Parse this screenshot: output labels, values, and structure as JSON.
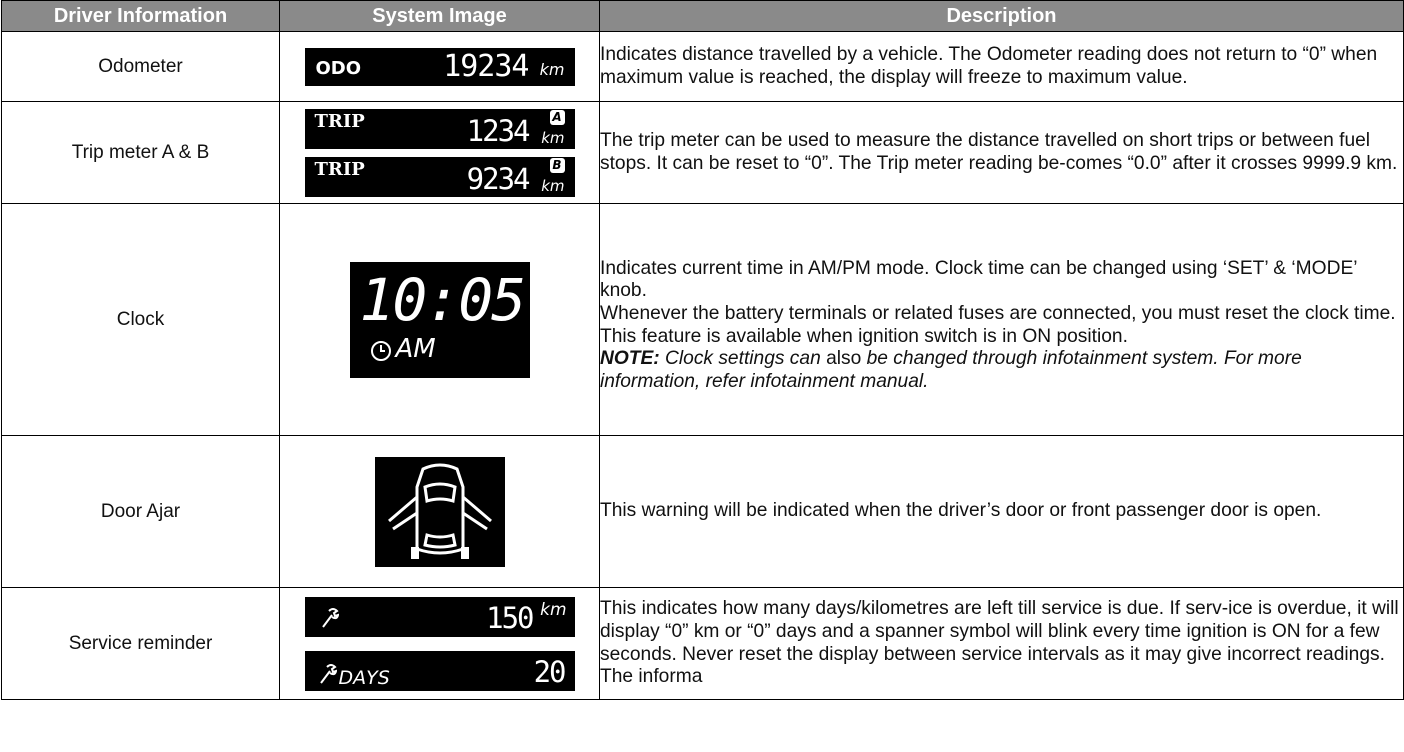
{
  "headers": [
    "Driver Information",
    "System Image",
    "Description"
  ],
  "rows": {
    "odometer": {
      "name": "Odometer",
      "display": {
        "label": "ODO",
        "value": "19234",
        "unit": "km"
      },
      "description": "Indicates distance travelled by a vehicle. The Odometer reading does not return to “0” when maximum value is reached, the display will freeze to maximum value."
    },
    "trip": {
      "name": "Trip meter A & B",
      "display_a": {
        "label": "TRIP",
        "value": "1234",
        "badge": "A",
        "unit": "km"
      },
      "display_b": {
        "label": "TRIP",
        "value": "9234",
        "badge": "B",
        "unit": "km"
      },
      "description": "The trip meter can be used to measure the distance travelled on short trips or between fuel stops. It can be reset to “0”. The Trip meter reading be-comes “0.0” after it crosses 9999.9 km."
    },
    "clock": {
      "name": "Clock",
      "display": {
        "time": "10:05",
        "ampm": "AM"
      },
      "desc1": "Indicates current time in AM/PM mode. Clock time can be changed using ‘SET’ & ‘MODE’ knob.",
      "desc2": "Whenever the battery terminals or related fuses are connected, you must reset the clock time. This feature is available when ignition switch is in ON position.",
      "note_label": "NOTE:",
      "note_part1": " Clock settings can",
      "note_part2": " also ",
      "note_part3": "be changed through infotainment system. For more information, refer infotainment manual."
    },
    "door": {
      "name": "Door Ajar",
      "description": "This warning will be indicated when the driver’s door or front passenger door is open."
    },
    "service": {
      "name": "Service reminder",
      "display_km": {
        "value": "150",
        "unit": "km"
      },
      "display_days": {
        "label": "DAYS",
        "value": "20"
      },
      "description": "This indicates how many days/kilometres are left till service is due. If serv-ice is overdue, it will display “0” km or “0” days and a spanner symbol will blink every time ignition is ON for a few seconds. Never reset the display between service intervals as it may give incorrect readings. The informa"
    }
  }
}
